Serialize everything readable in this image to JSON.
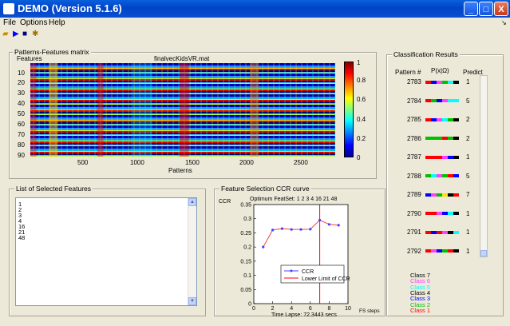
{
  "window": {
    "title": "DEMO (Version 5.1.6)",
    "minimize": "_",
    "maximize": "□",
    "close": "X"
  },
  "menu": [
    "File",
    "Options",
    "Help"
  ],
  "toolbar": {
    "icons": [
      "open-folder-icon",
      "play-icon",
      "stop-icon",
      "settings-icon"
    ]
  },
  "matrix_panel": {
    "title": "Patterns-Features matrix",
    "plot_title": "finalvecKidsVR.mat",
    "ylabel": "Features",
    "xlabel": "Patterns",
    "yticks": [
      "10",
      "20",
      "30",
      "40",
      "50",
      "60",
      "70",
      "80",
      "90"
    ],
    "xticks": [
      "500",
      "1000",
      "1500",
      "2000",
      "2500"
    ],
    "colorbar_ticks": [
      "1",
      "0.8",
      "0.6",
      "0.4",
      "0.2",
      "0"
    ]
  },
  "selected_features": {
    "title": "List of Selected Features",
    "items": [
      "1",
      "2",
      "3",
      "4",
      "16",
      "21",
      "48"
    ]
  },
  "ccr_panel": {
    "title": "Feature Selection CCR curve"
  },
  "chart_data": {
    "type": "line",
    "title": "Optimum FeatSet: 1   2   3   4  16  21  48",
    "ylabel": "CCR",
    "xlabel": "FS steps",
    "caption": "Time Lapse: 72.3443 secs",
    "x": [
      1,
      2,
      3,
      4,
      5,
      6,
      7,
      8,
      9
    ],
    "series": [
      {
        "name": "CCR",
        "values": [
          0.2,
          0.26,
          0.265,
          0.262,
          0.262,
          0.263,
          0.295,
          0.28,
          0.277
        ],
        "color": "#4040ff"
      }
    ],
    "vline": {
      "name": "Lower Limit of CCR",
      "x": 7,
      "color": "#ff0000"
    },
    "xlim": [
      0,
      10
    ],
    "ylim": [
      0,
      0.35
    ],
    "yticks": [
      "0.35",
      "0.3",
      "0.25",
      "0.2",
      "0.15",
      "0.1",
      "0.05",
      "0"
    ],
    "xticks": [
      "0",
      "2",
      "4",
      "6",
      "8",
      "10"
    ],
    "legend": "bottom-right"
  },
  "classification": {
    "title": "Classification Results",
    "headers": [
      "Pattern #",
      "P(x|Ω)",
      "Predict"
    ],
    "rows": [
      {
        "pattern": "2783",
        "predict": "1",
        "colors": [
          "#ff0000",
          "#0000ff",
          "#ff40ff",
          "#00c000",
          "#00ffff",
          "#000000"
        ]
      },
      {
        "pattern": "2784",
        "predict": "5",
        "colors": [
          "#ff0000",
          "#00c000",
          "#0000ff",
          "#ff40ff",
          "#00ffff",
          "#00ffff"
        ]
      },
      {
        "pattern": "2785",
        "predict": "2",
        "colors": [
          "#ff0000",
          "#0000ff",
          "#ff40ff",
          "#00ffff",
          "#00c000",
          "#000000"
        ]
      },
      {
        "pattern": "2786",
        "predict": "2",
        "colors": [
          "#00c000",
          "#00c000",
          "#00c000",
          "#ff0000",
          "#00c000",
          "#000000"
        ]
      },
      {
        "pattern": "2787",
        "predict": "1",
        "colors": [
          "#ff0000",
          "#ff0000",
          "#ff0000",
          "#ff40ff",
          "#0000ff",
          "#000000"
        ]
      },
      {
        "pattern": "2788",
        "predict": "5",
        "colors": [
          "#00c000",
          "#00ffff",
          "#ff40ff",
          "#00c000",
          "#ff0000",
          "#0000ff"
        ]
      },
      {
        "pattern": "2789",
        "predict": "7",
        "colors": [
          "#0000ff",
          "#ff40ff",
          "#00c000",
          "#ffe000",
          "#000000",
          "#ff0000"
        ]
      },
      {
        "pattern": "2790",
        "predict": "1",
        "colors": [
          "#ff0000",
          "#ff0000",
          "#ff40ff",
          "#0000ff",
          "#00ffff",
          "#000000"
        ]
      },
      {
        "pattern": "2791",
        "predict": "1",
        "colors": [
          "#ff0000",
          "#0000ff",
          "#ff0000",
          "#ff40ff",
          "#000000",
          "#00ffff"
        ]
      },
      {
        "pattern": "2792",
        "predict": "1",
        "colors": [
          "#ff0000",
          "#ff40ff",
          "#0000ff",
          "#00c000",
          "#ff0000",
          "#000000"
        ]
      }
    ],
    "legend": [
      {
        "label": "Class 7",
        "color": "#000000"
      },
      {
        "label": "Class 6",
        "color": "#ff40ff"
      },
      {
        "label": "Class 5",
        "color": "#00ffff"
      },
      {
        "label": "Class 4",
        "color": "#000000"
      },
      {
        "label": "Class 3",
        "color": "#0000ff"
      },
      {
        "label": "Class 2",
        "color": "#00c000"
      },
      {
        "label": "Class 1",
        "color": "#ff0000"
      }
    ]
  }
}
